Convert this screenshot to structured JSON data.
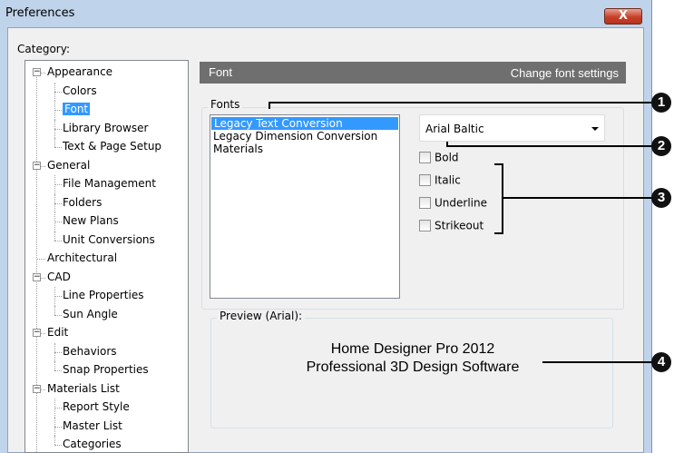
{
  "window": {
    "title": "Preferences",
    "close_label": "X"
  },
  "category": {
    "label": "Category:",
    "items": [
      {
        "label": "Appearance",
        "level": 0,
        "expanded": true
      },
      {
        "label": "Colors",
        "level": 1
      },
      {
        "label": "Font",
        "level": 1,
        "selected": true
      },
      {
        "label": "Library Browser",
        "level": 1
      },
      {
        "label": "Text & Page Setup",
        "level": 1
      },
      {
        "label": "General",
        "level": 0,
        "expanded": true
      },
      {
        "label": "File Management",
        "level": 1
      },
      {
        "label": "Folders",
        "level": 1
      },
      {
        "label": "New Plans",
        "level": 1
      },
      {
        "label": "Unit Conversions",
        "level": 1
      },
      {
        "label": "Architectural",
        "level": 0
      },
      {
        "label": "CAD",
        "level": 0,
        "expanded": true
      },
      {
        "label": "Line Properties",
        "level": 1
      },
      {
        "label": "Sun Angle",
        "level": 1
      },
      {
        "label": "Edit",
        "level": 0,
        "expanded": true
      },
      {
        "label": "Behaviors",
        "level": 1
      },
      {
        "label": "Snap Properties",
        "level": 1
      },
      {
        "label": "Materials List",
        "level": 0,
        "expanded": true
      },
      {
        "label": "Report Style",
        "level": 1
      },
      {
        "label": "Master List",
        "level": 1
      },
      {
        "label": "Categories",
        "level": 1
      }
    ]
  },
  "panel": {
    "title": "Font",
    "subtitle": "Change font settings",
    "fonts_group_label": "Fonts",
    "font_list": [
      "Legacy Text Conversion",
      "Legacy Dimension Conversion",
      "Materials"
    ],
    "selected_font_index": 0,
    "font_name": "Arial Baltic",
    "styles": [
      {
        "label": "Bold",
        "checked": false
      },
      {
        "label": "Italic",
        "checked": false
      },
      {
        "label": "Underline",
        "checked": false
      },
      {
        "label": "Strikeout",
        "checked": false
      }
    ],
    "preview_label": "Preview (Arial):",
    "preview_line1": "Home Designer Pro 2012",
    "preview_line2": "Professional 3D Design Software"
  },
  "callouts": [
    "1",
    "2",
    "3",
    "4"
  ],
  "colors": {
    "header_bar": "#6f6f6f",
    "selection": "#3399ff",
    "frame": "#bfd3ea"
  }
}
